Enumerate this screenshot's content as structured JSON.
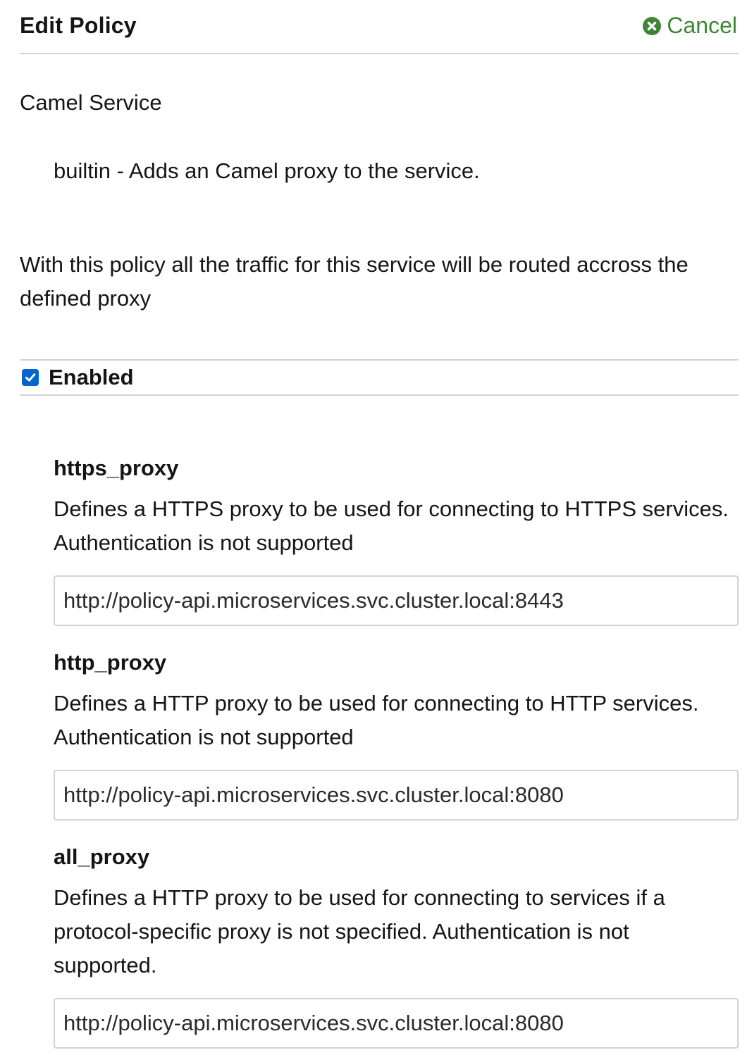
{
  "header": {
    "title": "Edit Policy",
    "cancel_label": "Cancel",
    "cancel_icon": "times-circle-icon",
    "accent_color": "#3e8635"
  },
  "service": {
    "name": "Camel Service",
    "builtin_description": "builtin - Adds an Camel proxy to the service."
  },
  "policy": {
    "description": "With this policy all the traffic for this service will be routed accross the defined proxy",
    "enabled_label": "Enabled",
    "enabled": true
  },
  "fields": [
    {
      "title": "https_proxy",
      "description": "Defines a HTTPS proxy to be used for connecting to HTTPS services. Authentication is not supported",
      "value": "http://policy-api.microservices.svc.cluster.local:8443"
    },
    {
      "title": "http_proxy",
      "description": "Defines a HTTP proxy to be used for connecting to HTTP services. Authentication is not supported",
      "value": "http://policy-api.microservices.svc.cluster.local:8080"
    },
    {
      "title": "all_proxy",
      "description": "Defines a HTTP proxy to be used for connecting to services if a protocol-specific proxy is not specified. Authentication is not supported.",
      "value": "http://policy-api.microservices.svc.cluster.local:8080"
    }
  ]
}
